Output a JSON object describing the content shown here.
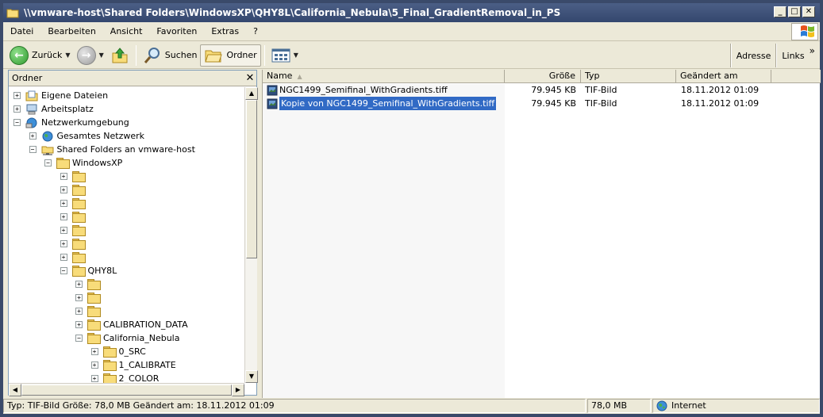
{
  "window": {
    "title": "\\\\vmware-host\\Shared Folders\\WindowsXP\\QHY8L\\California_Nebula\\5_Final_GradientRemoval_in_PS",
    "controls": {
      "minimize": "_",
      "maximize": "□",
      "close": "✕"
    }
  },
  "menu": [
    "Datei",
    "Bearbeiten",
    "Ansicht",
    "Favoriten",
    "Extras",
    "?"
  ],
  "toolbar": {
    "back_label": "Zurück",
    "search_label": "Suchen",
    "folders_label": "Ordner",
    "address_label": "Adresse",
    "links_label": "Links",
    "more_glyph": "»"
  },
  "folder_pane": {
    "title": "Ordner",
    "close_glyph": "✕",
    "tree": [
      {
        "label": "Eigene Dateien",
        "depth": 0,
        "expander": "+",
        "icon": "my-documents-icon"
      },
      {
        "label": "Arbeitsplatz",
        "depth": 0,
        "expander": "+",
        "icon": "my-computer-icon"
      },
      {
        "label": "Netzwerkumgebung",
        "depth": 0,
        "expander": "−",
        "icon": "network-places-icon"
      },
      {
        "label": "Gesamtes Netzwerk",
        "depth": 1,
        "expander": "+",
        "icon": "globe-icon"
      },
      {
        "label": "Shared Folders an vmware-host",
        "depth": 1,
        "expander": "−",
        "icon": "network-share-icon"
      },
      {
        "label": "WindowsXP",
        "depth": 2,
        "expander": "−",
        "icon": "folder-icon"
      },
      {
        "label": "",
        "depth": 3,
        "expander": "+",
        "icon": "folder-icon"
      },
      {
        "label": "",
        "depth": 3,
        "expander": "+",
        "icon": "folder-icon"
      },
      {
        "label": "",
        "depth": 3,
        "expander": "+",
        "icon": "folder-icon"
      },
      {
        "label": "",
        "depth": 3,
        "expander": "+",
        "icon": "folder-icon"
      },
      {
        "label": "",
        "depth": 3,
        "expander": "+",
        "icon": "folder-icon"
      },
      {
        "label": "",
        "depth": 3,
        "expander": "+",
        "icon": "folder-icon"
      },
      {
        "label": "",
        "depth": 3,
        "expander": "+",
        "icon": "folder-icon"
      },
      {
        "label": "QHY8L",
        "depth": 3,
        "expander": "−",
        "icon": "folder-icon"
      },
      {
        "label": "",
        "depth": 4,
        "expander": "+",
        "icon": "folder-icon"
      },
      {
        "label": "",
        "depth": 4,
        "expander": "+",
        "icon": "folder-icon"
      },
      {
        "label": "",
        "depth": 4,
        "expander": "+",
        "icon": "folder-icon"
      },
      {
        "label": "CALIBRATION_DATA",
        "depth": 4,
        "expander": "+",
        "icon": "folder-icon"
      },
      {
        "label": "California_Nebula",
        "depth": 4,
        "expander": "−",
        "icon": "folder-icon"
      },
      {
        "label": "0_SRC",
        "depth": 5,
        "expander": "+",
        "icon": "folder-icon"
      },
      {
        "label": "1_CALIBRATE",
        "depth": 5,
        "expander": "+",
        "icon": "folder-icon"
      },
      {
        "label": "2_COLOR",
        "depth": 5,
        "expander": "+",
        "icon": "folder-icon"
      }
    ]
  },
  "file_list": {
    "columns": [
      {
        "label": "Name",
        "sort_glyph": "▲"
      },
      {
        "label": "Größe"
      },
      {
        "label": "Typ"
      },
      {
        "label": "Geändert am"
      }
    ],
    "rows": [
      {
        "name": "NGC1499_Semifinal_WithGradients.tiff",
        "size": "79.945 KB",
        "type": "TIF-Bild",
        "modified": "18.11.2012 01:09",
        "selected": false
      },
      {
        "name": "Kopie von NGC1499_Semifinal_WithGradients.tiff",
        "size": "79.945 KB",
        "type": "TIF-Bild",
        "modified": "18.11.2012 01:09",
        "selected": true
      }
    ]
  },
  "status": {
    "info": "Typ: TIF-Bild Größe: 78,0 MB Geändert am: 18.11.2012 01:09",
    "size": "78,0 MB",
    "zone": "Internet"
  },
  "colors": {
    "selection": "#316ac5",
    "titlebar": "#34476e",
    "chrome": "#ece9d8"
  }
}
